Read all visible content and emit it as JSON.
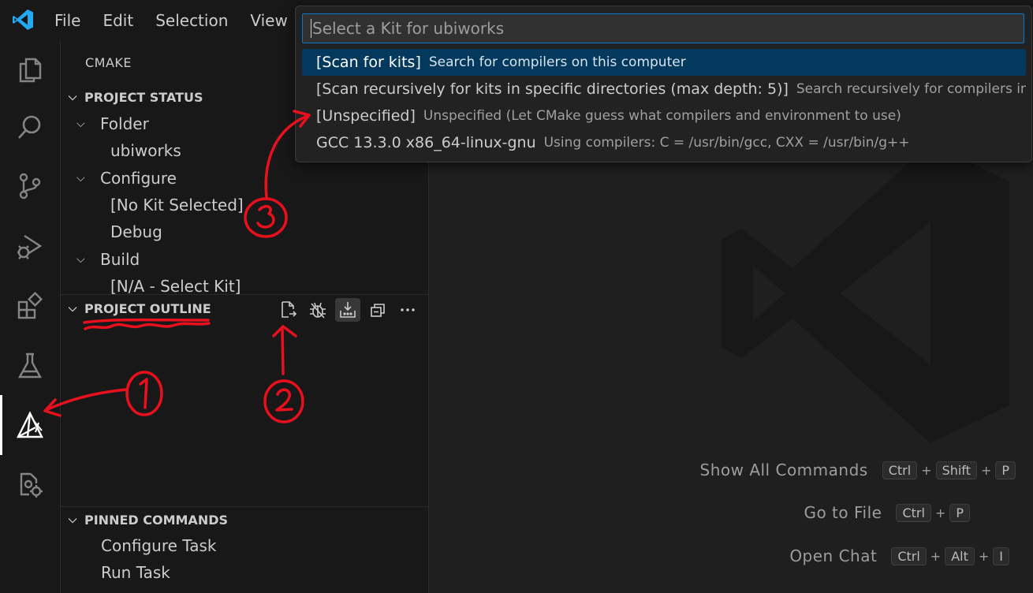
{
  "menu": {
    "items": [
      "File",
      "Edit",
      "Selection",
      "View"
    ]
  },
  "sidebar": {
    "title": "CMAKE",
    "project_status": {
      "header": "PROJECT STATUS",
      "folder_label": "Folder",
      "folder_value": "ubiworks",
      "configure_label": "Configure",
      "configure_kit": "[No Kit Selected]",
      "configure_variant": "Debug",
      "build_label": "Build",
      "build_value": "[N/A - Select Kit]"
    },
    "project_outline": {
      "header": "PROJECT OUTLINE"
    },
    "pinned_commands": {
      "header": "PINNED COMMANDS",
      "items": [
        "Configure Task",
        "Run Task"
      ]
    }
  },
  "quickpick": {
    "placeholder": "Select a Kit for ubiworks",
    "items": [
      {
        "label": "[Scan for kits]",
        "description": "Search for compilers on this computer"
      },
      {
        "label": "[Scan recursively for kits in specific directories (max depth: 5)]",
        "description": "Search recursively for compilers in …"
      },
      {
        "label": "[Unspecified]",
        "description": "Unspecified (Let CMake guess what compilers and environment to use)"
      },
      {
        "label": "GCC 13.3.0 x86_64-linux-gnu",
        "description": "Using compilers: C = /usr/bin/gcc, CXX = /usr/bin/g++"
      }
    ]
  },
  "shortcuts": [
    {
      "label": "Show All Commands",
      "keys": [
        "Ctrl",
        "Shift",
        "P"
      ]
    },
    {
      "label": "Go to File",
      "keys": [
        "Ctrl",
        "P"
      ]
    },
    {
      "label": "Open Chat",
      "keys": [
        "Ctrl",
        "Alt",
        "I"
      ]
    }
  ],
  "annotations": {
    "markers": [
      "1",
      "2",
      "3"
    ],
    "color": "#e8101d"
  },
  "colors": {
    "accent": "#0078d4",
    "selection": "#04395e",
    "background": "#1f1f1f",
    "sidebar": "#181818"
  }
}
